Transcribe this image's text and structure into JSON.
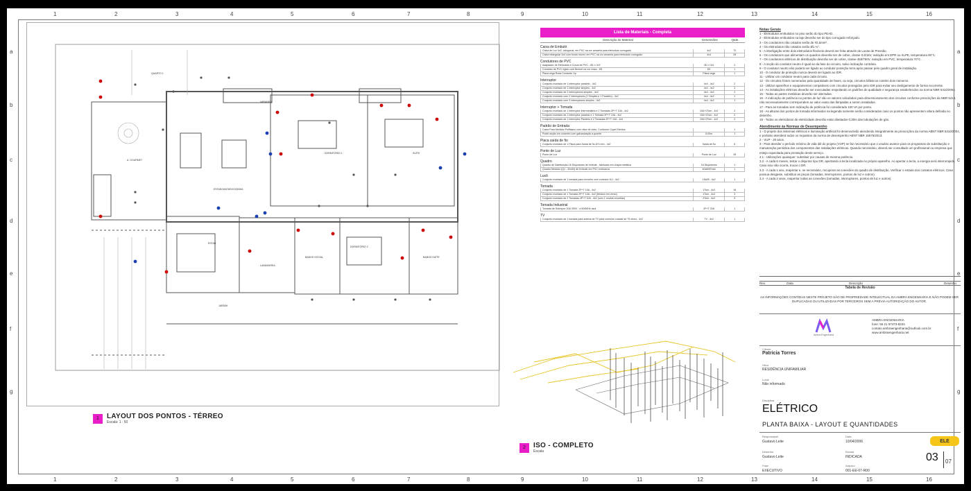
{
  "sheet": {
    "grid_columns": [
      "1",
      "2",
      "3",
      "4",
      "5",
      "6",
      "7",
      "8",
      "9",
      "10",
      "11",
      "12",
      "13",
      "14",
      "15",
      "16"
    ],
    "grid_rows": [
      "a",
      "b",
      "c",
      "d",
      "e",
      "f",
      "g"
    ]
  },
  "floorplan": {
    "rooms": [
      "QUARTO 1",
      "A. GOURMET",
      "ESTAR/JANTAR/COZINHA",
      "DORMITÓRIO 1",
      "SUÍTE",
      "ESTAR",
      "LAVANDERIA",
      "BANHO SOCIAL",
      "DORMITÓRIO 2",
      "BANHO SUÍTE",
      "JARDIM",
      "VARANDA"
    ],
    "view_label": {
      "number": "1",
      "title": "LAYOUT DOS PONTOS - TÉRREO",
      "scale": "Escala: 1 : 50"
    }
  },
  "iso_view": {
    "number": "2",
    "title": "ISO - COMPLETO",
    "scale": "Escala"
  },
  "materials": {
    "title": "Lista de Materiais - Completa",
    "columns": [
      "Descrição do Material",
      "Dimensões",
      "Qtde."
    ],
    "sections": [
      {
        "name": "Caixa de Embutir",
        "rows": [
          [
            "Caixa de Luz 4x2, octogonal, em PVC na cor amarela para eletroduto corrugado",
            "4x2",
            "72"
          ],
          [
            "Caixa retangular 4x4 com fundo móvel, em PVC na cor amarela para eletroduto corrugado",
            "4x4",
            "28"
          ]
        ]
      },
      {
        "name": "Condutores de PVC",
        "rows": [
          [
            "Adaptador de Eletroduto e Curva de PVC - Ø1 x 3/4\"",
            "Ø1 x 3/4",
            "2"
          ],
          [
            "Condutor de PVC rígido com flexível na cor cinza - Ø1",
            "Ø1",
            "1"
          ],
          [
            "Placa cega Roda Conduíte 1/p",
            "Placa cega",
            "1"
          ]
        ]
      },
      {
        "name": "Interruptor",
        "rows": [
          [
            "Conjunto montado de 1 interruptor paralelo - 4x2",
            "4x4 - 4x2",
            "2"
          ],
          [
            "Conjunto montado de 1 interruptor simples - 4x2",
            "4x4 - 4x2",
            "3"
          ],
          [
            "Conjunto montado de 2 interruptores simples - 4x2",
            "4x4 - 4x2",
            "2"
          ],
          [
            "Conjunto montado com 2 interruptores (2 Simples e 1 Paralelo) - 4x2",
            "4x4 - 4x2",
            "1"
          ],
          [
            "Conjunto montado com 3 interruptores simples - 4x2",
            "4x4 - 4x2",
            "1"
          ]
        ]
      },
      {
        "name": "Interruptor + Tomada",
        "rows": [
          [
            "Conjunto montado de 1 interruptor intermediário e 2 Tomadas 2P+T 10A - 4x2",
            "10A+2Tom - 4x2",
            "2"
          ],
          [
            "Conjunto montado de 1 interruptor paralelo e 1 Tomada 2P+T 10A - 4x2",
            "10A+1Tom - 4x2",
            "2"
          ],
          [
            "Conjunto montado de 1 interruptor Paralelo e 2 Tomadas 2P+T 10A - 4x2",
            "10A+2Tom - 4x2",
            "2"
          ]
        ]
      },
      {
        "name": "Padrão de Entrada",
        "rows": [
          [
            "Caixa Para Medidor Polifásico com visor de vidro, Conforme Copel Eletrica",
            "",
            "1"
          ],
          [
            "Poste seção em concreto com galvanização a quente",
            "5.00m",
            "1"
          ]
        ]
      },
      {
        "name": "Placa saída de fio",
        "rows": [
          [
            "Conjunto montado de 1 Placa para Saída de fio Ø 5 mm - 4x2",
            "Saída de fio",
            "6"
          ]
        ]
      },
      {
        "name": "Ponto de Luz",
        "rows": [
          [
            "Ponto de Luz",
            "Ponto de Luz",
            "28"
          ]
        ]
      },
      {
        "name": "Quadro",
        "rows": [
          [
            "Quadro de Distribuição 16 Disjuntores de embutir - fabricado em chapa metálica",
            "16 Disjuntores",
            "1"
          ],
          [
            "Quadro Medidor (Q1 - 40x60) de Embutir em PVC embranca",
            "40x60/Embr",
            "1"
          ]
        ]
      },
      {
        "name": "Luxô",
        "rows": [
          [
            "Conjunto montado de 1 tomada para chuveiro com conector 6,0 - 4x2",
            "15A/B - 4x2",
            "1"
          ]
        ]
      },
      {
        "name": "Tomada",
        "rows": [
          [
            "Conjunto montado de 1 Tomada 2P+T 10A - 4x2",
            "1Tom - 4x2",
            "16"
          ],
          [
            "Conjunto montado de 1 Tomada 2P+T 10A - 4x2 (Modulo em verso)",
            "1Tom - 4x2",
            "3"
          ],
          [
            "Conjunto montado de 2 Tomadas 2P+T 10A - 4x2 (com 1 modulo invertido)",
            "2Tom - 4x2",
            "5"
          ]
        ]
      },
      {
        "name": "Tomada Industrial",
        "rows": [
          [
            "Tomada de Sobrepor 20A 250V - a 50/60Hz azul",
            "2P+T 32A",
            "1"
          ]
        ]
      },
      {
        "name": "TV",
        "rows": [
          [
            "Conjunto montado de 1 tomada para antena de TV para conector coaxial de 75 ohms - 4x2",
            "TV - 4x2",
            "1"
          ]
        ]
      }
    ]
  },
  "notes": {
    "title": "Notas Gerais",
    "items": [
      "1 - Eletrodutos embutidos no piso serão do tipo PEAD.",
      "2 - Eletrodutos embutidos na laje deverão ser do tipo corrugado reforçado.",
      "3 - Os condutores não cotados serão de #2,5mm².",
      "4 - Os eletrodutos não cotados serão Ø1 ¾\".",
      "5 - A interligação entre dois eletrodutos flexíveis deverá ser feita através de Luvas de Pressão.",
      "6 - Os condutores que alimentam os quadros deverão ser de cobre, classe 0,6/1kV, isolação em EPR ou XLPE, temperatura 90°C.",
      "7 - Os condutores elétricos de distribuição deverão ser de cobre, classe 450/750V, isolação em PVC, temperatura 70°C.",
      "8 - A seção do condutor neutro é igual ao da fase do circuito, salvo indicação contrária.",
      "9 - O condutor neutro não poderá ser ligado ao condutor proteção terra após passar pelo quadro geral de instalação.",
      "10 - O condutor de proteção nunca deverá ser ligado ao IDR.",
      "11 - Utilizar um condutor neutro para cada circuito.",
      "12 - Os circuitos foram numerados pela quantidade de fases, ou seja, circuitos bifásicos contém dois números.",
      "13 - Utilizar aparelhos e equipamentos compatíveis com circuitos protegidos pelo IDR para evitar seu desligamento de forma recorrente.",
      "14 - As instalações elétricas deverão ser executadas respeitando os padrões de qualidade e segurança estabelecidos na norma NBR 5410/2004.",
      "15 - Todas as partes metálicas deverão ser aterradas.",
      "16 - A indicação de potência no pontos de luz são os valores calculados para dimensionamento dos circuitos conforme prescrições da NBR 5410, não necessariamente correspondem ao valor exato das lâmpadas a serem instaladas.",
      "17 - Para as tomadas sem indicação de potência foi considerado 100 VA por ponto.",
      "18 - As alturas dos pontos de tomada informados na legenda somente serão considerados caso os pontos não apresentem altura definida no desenho.",
      "19 - Todos os eletrodutos de eletricidade deverão estar afastados 0,30m das tubulações de gás."
    ],
    "norms_title": "Atendimento às Normas de Desempenho",
    "norms_items": [
      "1 - O projeto dos sistemas elétricos e iluminação artificial foi desenvolvido atendendo integralmente as prescrições da norma ABNT NBR 5410/2004, e portanto atenderá todos os requisitos da norma de desempenho ABNT NBR 15575/2013.",
      "2 - VUP - 20 anos.",
      "3 - Para atender o período mínimo de vida útil do projeto (VUP) se faz necessário que o usuário avance para os programas de substituição e manutenção periódica dos componentes das instalações elétricas. Quando necessário, deverá ser consultado um profissional ou empresa que esteja capacitada para prestação deste serviço.",
      "3.1 - Utilizações quaisquer: substituir por causas de mesma potência.",
      "3.2 - A cada 6 meses, testar o disjuntor tipo DR, apertando a tecla localizada no próprio aparelho. Ao apertar a tecla, a energia será interrompida. Caso isso não ocorra, trocar o DR.",
      "3.3 - A cada 1 ano, reapertar e, se necessário, recuperar as conexões do quadro de distribuição. Verificar o estado dos contatos elétricos. Caso possua desgaste, substituir as peças (tomadas, interruptores, pontos de luz e outros).",
      "3.4 - A cada 2 anos, reapertar todas as conexões (tomadas, interruptores, pontos de luz e outros)."
    ]
  },
  "revision": {
    "columns": [
      "Rev.",
      "Data",
      "Descrição",
      "Desenho"
    ],
    "caption": "Tabela de Revisão"
  },
  "disclaimer": "AS INFORMAÇÕES CONTIDAS NESTE PROJETO SÃO DE PROPRIEDADE INTELECTUAL DA AMBRA ENGENHARIA E NÃO PODEM SER DUPLICADAS OU UTILIZADAS POR TERCEIROS SEM A PRÉVIA AUTORIZAÇÃO DO AUTOR.",
  "company": {
    "logo_text": "Ambra Engenharia",
    "name": "AMBRA ENGENHARIA",
    "phone": "fone: 55 21 97473-8234",
    "email": "contato.ambraengenharia@outlook.com.br",
    "site": "www.ambraengenharia.net"
  },
  "titleblock": {
    "client_label": "Cliente",
    "client": "Patricia Torres",
    "project_label": "Obra",
    "project": "RESIDÊNCIA UNIFAMILIAR",
    "location_label": "Local",
    "location": "Não informado",
    "discipline_label": "Disciplina",
    "discipline": "ELÉTRICO",
    "sheet_title": "PLANTA BAIXA - LAYOUT E QUANTIDADES",
    "author_label": "Responsável",
    "author": "Gustavo Leite",
    "date_label": "Data",
    "date": "10/04/2006",
    "drawn_label": "Desenho",
    "drawn": "Gustavo Leite",
    "scale_label": "Escala",
    "scale": "INDICADA",
    "phase_label": "Fase",
    "phase": "EXECUTIVO",
    "file_label": "Arquivo",
    "file": "001-EE-07-R00",
    "tag": "ELE",
    "sheet_number": "03",
    "sheet_total": "07"
  },
  "colors": {
    "accent": "#e91ec8",
    "tag": "#f5c518",
    "wire": "#e8c52a"
  }
}
